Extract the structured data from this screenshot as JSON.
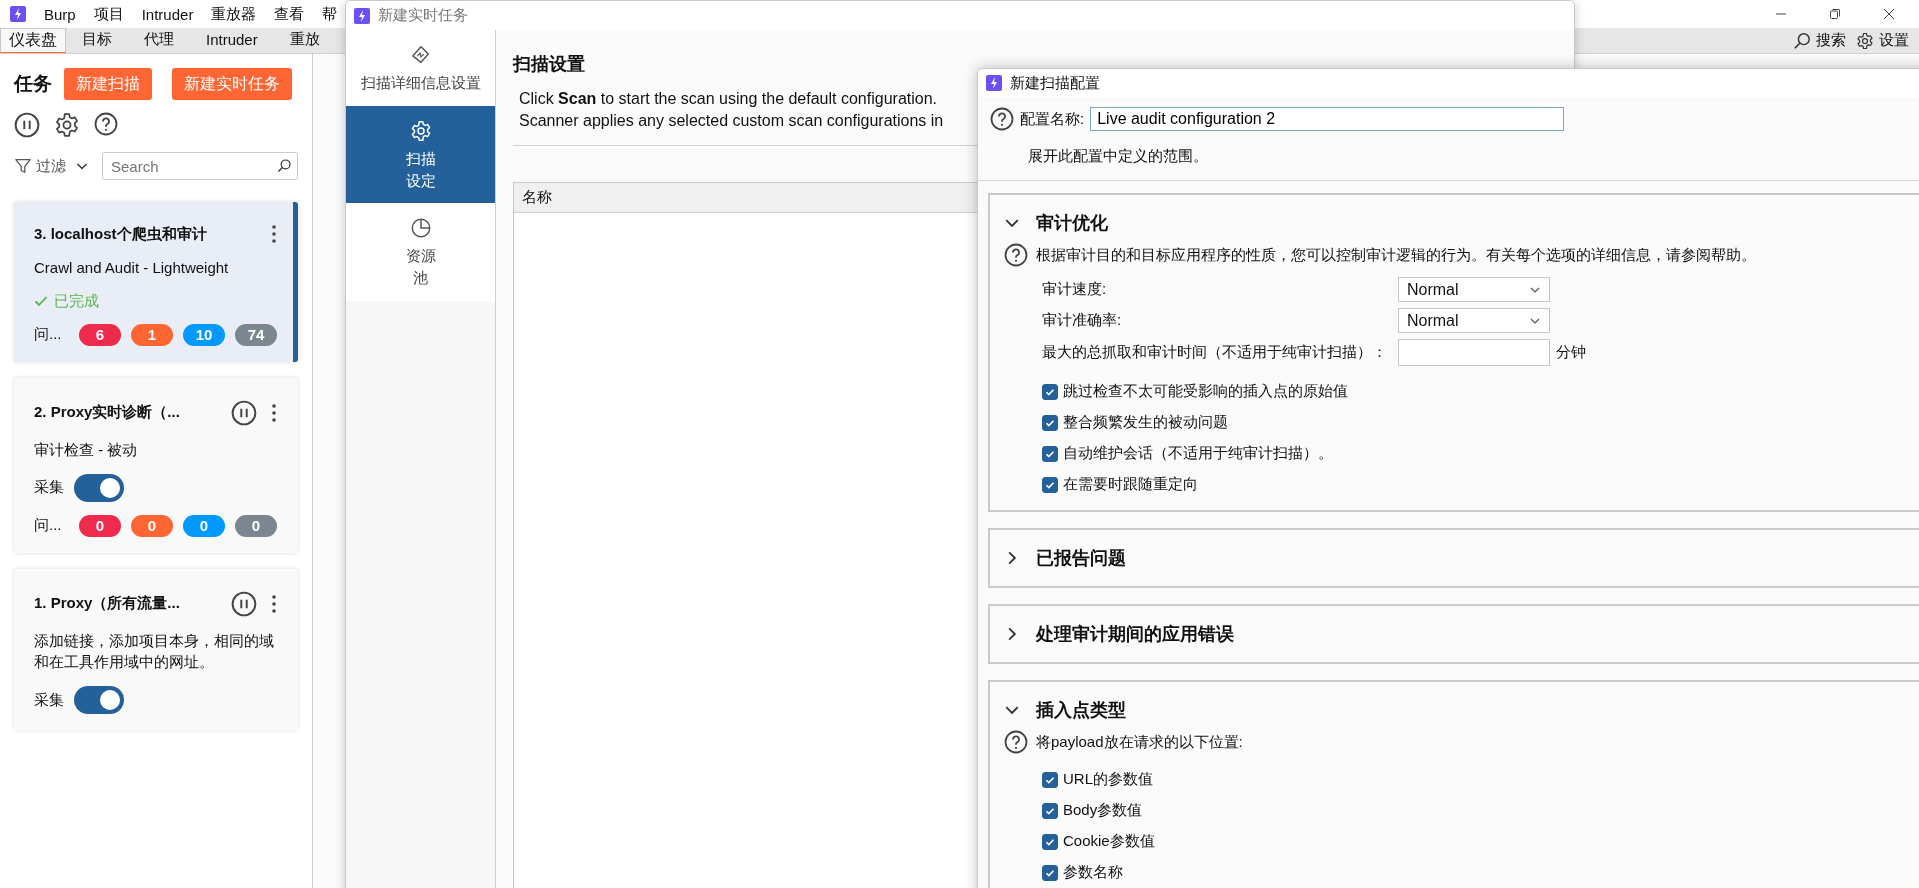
{
  "main_window": {
    "menu": [
      "Burp",
      "项目",
      "Intruder",
      "重放器",
      "查看",
      "帮"
    ],
    "tabs": [
      {
        "label": "仪表盘",
        "selected": true
      },
      {
        "label": "目标",
        "selected": false
      },
      {
        "label": "代理",
        "selected": false
      },
      {
        "label": "Intruder",
        "selected": false
      },
      {
        "label": "重放",
        "selected": false
      }
    ],
    "toolbar_actions": [
      "搜索",
      "设置"
    ],
    "tasks_panel": {
      "title": "任务",
      "buttons": [
        "新建扫描",
        "新建实时任务"
      ],
      "filter_label": "过滤",
      "search": {
        "placeholder": "Search"
      },
      "tasks": [
        {
          "title": "3. localhost个爬虫和审计",
          "selected": true,
          "pause_button": false,
          "description": "Crawl and Audit - Lightweight",
          "status": "已完成",
          "issues": {
            "label": "问...",
            "counts": [
              {
                "value": "6",
                "color": "#ee2a4d"
              },
              {
                "value": "1",
                "color": "#ff6633"
              },
              {
                "value": "10",
                "color": "#0099ff"
              },
              {
                "value": "74",
                "color": "#7b8691"
              }
            ]
          }
        },
        {
          "title": "2. Proxy实时诊断（...",
          "selected": false,
          "pause_button": true,
          "description": "审计检查 - 被动",
          "capture": {
            "label": "采集",
            "on": true
          },
          "issues": {
            "label": "问...",
            "counts": [
              {
                "value": "0",
                "color": "#ee2a4d"
              },
              {
                "value": "0",
                "color": "#ff6633"
              },
              {
                "value": "0",
                "color": "#0099ff"
              },
              {
                "value": "0",
                "color": "#7b8691"
              }
            ]
          }
        },
        {
          "title": "1. Proxy（所有流量...",
          "selected": false,
          "pause_button": true,
          "description": "添加链接，添加项目本身，相同的域和在工具作用域中的网址。",
          "capture": {
            "label": "采集",
            "on": true
          }
        }
      ]
    }
  },
  "live_task_window": {
    "title": "新建实时任务",
    "nav": [
      {
        "kind": "details",
        "lines": [
          "扫描详细信息设置"
        ],
        "selected": false
      },
      {
        "kind": "settings",
        "lines": [
          "扫描",
          "设定"
        ],
        "selected": true
      },
      {
        "kind": "resources",
        "lines": [
          "资源",
          "池"
        ],
        "selected": false
      }
    ],
    "heading": "扫描设置",
    "description_lines": [
      "Click **Scan** to start the scan using the default configuration.",
      "Scanner applies any selected custom scan configurations in"
    ],
    "table": {
      "columns": [
        "名称"
      ]
    }
  },
  "scan_config_dialog": {
    "title": "新建扫描配置",
    "name_label": "配置名称:",
    "name_value": "Live audit configuration 2",
    "note": "展开此配置中定义的范围。",
    "sections": [
      {
        "title": "审计优化",
        "expanded": true,
        "help": "根据审计目的和目标应用程序的性质，您可以控制审计逻辑的行为。有关每个选项的详细信息，请参阅帮助。",
        "fields": [
          {
            "kind": "select",
            "label": "审计速度:",
            "value": "Normal"
          },
          {
            "kind": "select",
            "label": "审计准确率:",
            "value": "Normal"
          },
          {
            "kind": "number",
            "label": "最大的总抓取和审计时间（不适用于纯审计扫描）：",
            "unit": "分钟"
          }
        ],
        "options": [
          {
            "label": "跳过检查不太可能受影响的插入点的原始值",
            "checked": true
          },
          {
            "label": "整合频繁发生的被动问题",
            "checked": true
          },
          {
            "label": "自动维护会话（不适用于纯审计扫描）。",
            "checked": true
          },
          {
            "label": "在需要时跟随重定向",
            "checked": true
          }
        ]
      },
      {
        "title": "已报告问题",
        "expanded": false
      },
      {
        "title": "处理审计期间的应用错误",
        "expanded": false
      },
      {
        "title": "插入点类型",
        "expanded": true,
        "help": "将payload放在请求的以下位置:",
        "options": [
          {
            "label": "URL的参数值",
            "checked": true
          },
          {
            "label": "Body参数值",
            "checked": true
          },
          {
            "label": "Cookie参数值",
            "checked": true
          },
          {
            "label": "参数名称",
            "checked": true
          }
        ]
      }
    ]
  }
}
